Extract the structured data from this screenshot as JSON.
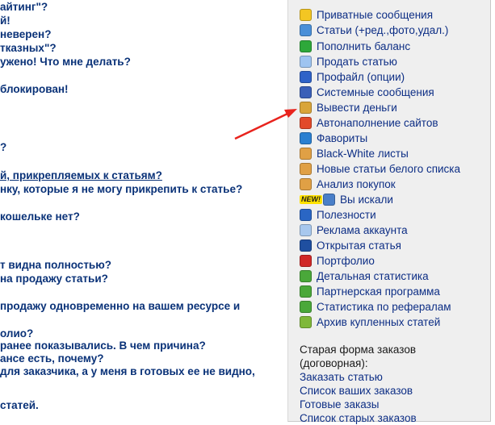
{
  "faq_lines": [
    "айтинг\"?",
    "й!",
    "неверен?",
    "тказных\"?",
    "ужено! Что мне делать?",
    "",
    "блокирован!",
    "",
    "",
    "?",
    "",
    "й, прикрепляемых к статьям?",
    "нку, которые я не могу прикрепить к статье?",
    "",
    "кошельке нет?",
    "",
    "",
    "т видна полностью?",
    "на продажу статьи?",
    "",
    "продажу одновременно на вашем ресурсе и",
    "",
    "олио?",
    "ранее показывались. В чем причина?",
    "ансе есть, почему?",
    "для заказчика, а у меня в готовых ее не видно,",
    "",
    "статей."
  ],
  "menu": [
    {
      "label": "Приватные сообщения",
      "icon": "message-icon",
      "color": "#f3c623"
    },
    {
      "label": "Статьи (+ред.,фото,удал.)",
      "icon": "articles-icon",
      "color": "#4a8fd8"
    },
    {
      "label": "Пополнить баланс",
      "icon": "plus-balance-icon",
      "color": "#2ea83a"
    },
    {
      "label": "Продать статью",
      "icon": "document-icon",
      "color": "#9ec4f0"
    },
    {
      "label": "Профайл (опции)",
      "icon": "profile-globe-icon",
      "color": "#2f62c8"
    },
    {
      "label": "Системные сообщения",
      "icon": "system-messages-icon",
      "color": "#3a5fb8"
    },
    {
      "label": "Вывести деньги",
      "icon": "withdraw-money-icon",
      "color": "#d9a53a"
    },
    {
      "label": "Автонаполнение сайтов",
      "icon": "autofill-icon",
      "color": "#e24a2a"
    },
    {
      "label": "Фавориты",
      "icon": "favorites-icon",
      "color": "#2a7fd0"
    },
    {
      "label": "Black-White листы",
      "icon": "handshake-icon",
      "color": "#e0a045"
    },
    {
      "label": "Новые статьи белого списка",
      "icon": "handshake-icon",
      "color": "#e0a045"
    },
    {
      "label": "Анализ покупок",
      "icon": "handshake-icon",
      "color": "#e0a045"
    },
    {
      "label": "Вы искали",
      "icon": "search-key-icon",
      "color": "#4a7fc8",
      "badge": "NEW!"
    },
    {
      "label": "Полезности",
      "icon": "globe-icon",
      "color": "#2a66c4"
    },
    {
      "label": "Реклама аккаунта",
      "icon": "ad-document-icon",
      "color": "#a8c8ee"
    },
    {
      "label": "Открытая статья",
      "icon": "open-article-icon",
      "color": "#1f4fa0"
    },
    {
      "label": "Портфолио",
      "icon": "portfolio-icon",
      "color": "#d02828"
    },
    {
      "label": "Детальная статистика",
      "icon": "money-stack-icon",
      "color": "#4aa83a"
    },
    {
      "label": "Партнерская программа",
      "icon": "money-stack-icon",
      "color": "#4aa83a"
    },
    {
      "label": "Статистика по рефералам",
      "icon": "money-stack-icon",
      "color": "#4aa83a"
    },
    {
      "label": "Архив купленных статей",
      "icon": "archive-icon",
      "color": "#7fb83a"
    }
  ],
  "old_orders": {
    "heading_line1": "Старая форма заказов",
    "heading_line2": "(договорная):",
    "links": [
      "Заказать статью",
      "Список ваших заказов",
      "Готовые заказы",
      "Список старых заказов"
    ]
  },
  "colors": {
    "faq_text": "#0a3278",
    "menu_link": "#0d2e85",
    "sidebar_bg": "#efefef",
    "arrow": "#e8231d"
  }
}
